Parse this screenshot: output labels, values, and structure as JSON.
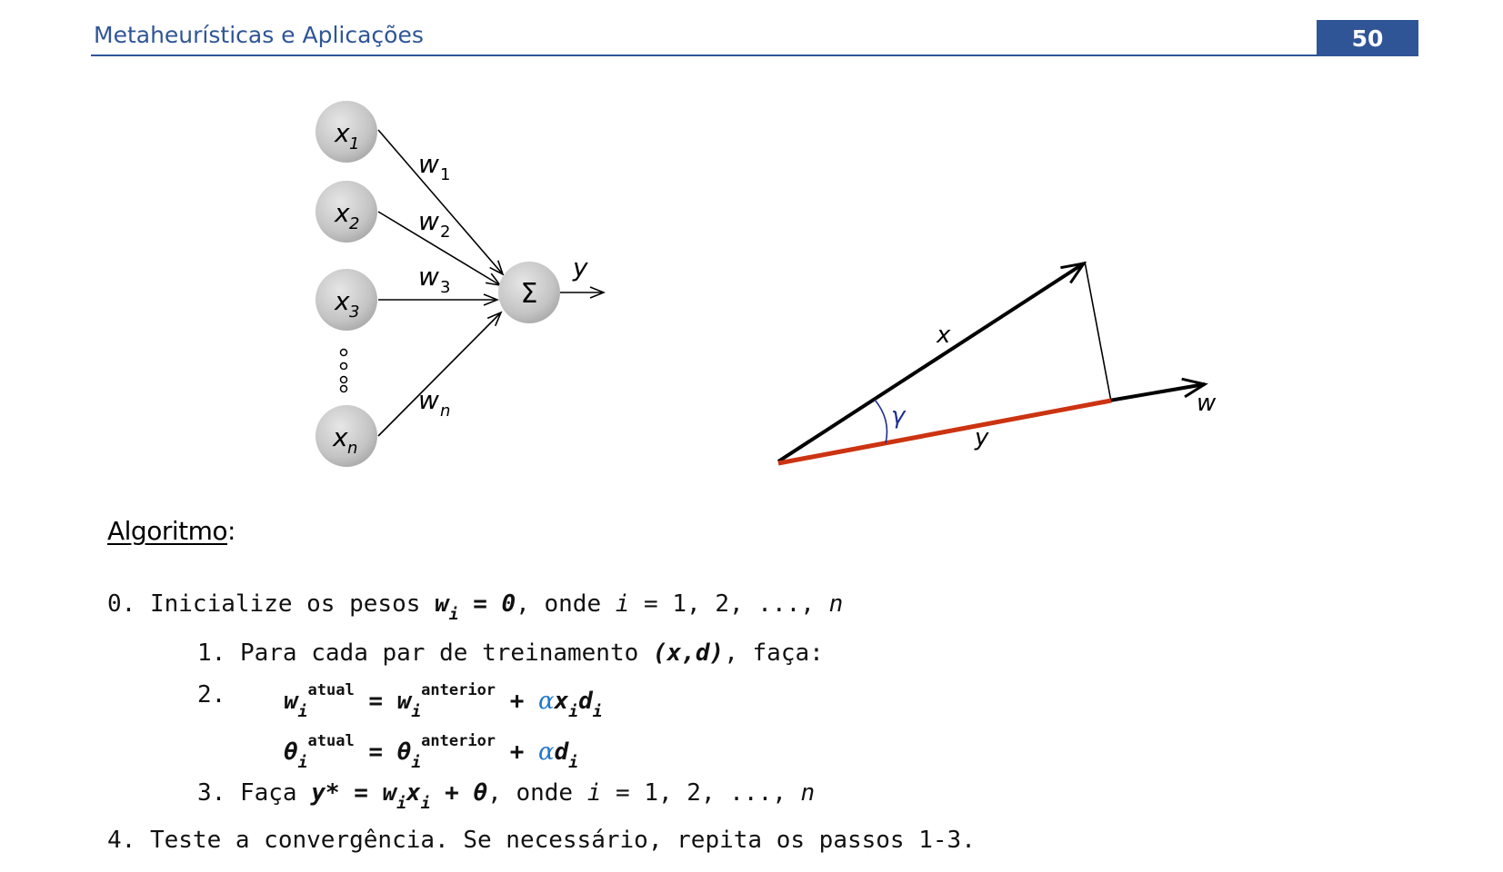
{
  "header": {
    "title": "Metaheurísticas e Aplicações",
    "page_number": "50"
  },
  "neuron_diagram": {
    "inputs": [
      "x",
      "x",
      "x",
      "x"
    ],
    "input_subscripts": [
      "1",
      "2",
      "3",
      "n"
    ],
    "weights": [
      "w",
      "w",
      "w",
      "w"
    ],
    "weight_subscripts": [
      "1",
      "2",
      "3",
      "n"
    ],
    "sum_symbol": "Σ",
    "output_label": "y"
  },
  "vector_diagram": {
    "x_label": "x",
    "w_label": "w",
    "y_label": "y",
    "angle_label": "γ"
  },
  "algorithm": {
    "heading": "Algoritmo",
    "heading_colon": ":",
    "line0": {
      "num": "0. ",
      "text": "Inicialize os pesos ",
      "var": "w",
      "sub": "i",
      "eq": " = ",
      "zero": "0",
      "comma": ", onde ",
      "i": "i",
      "range": " = 1, 2, ..., ",
      "n": "n"
    },
    "line1": {
      "num": "1. ",
      "text": "Para cada par de treinamento ",
      "pair": "(x,d)",
      "rest": ", faça:"
    },
    "line2": {
      "num": "2.",
      "w": "w",
      "sub": "i",
      "sup_cur": "atual",
      "eq": " = ",
      "sup_prev": "anterior",
      "plus": " + ",
      "alpha": "α",
      "x": "x",
      "d": "d"
    },
    "line2b": {
      "theta": "θ",
      "sub": "i",
      "sup_cur": "atual",
      "eq": " = ",
      "sup_prev": "anterior",
      "plus": " + ",
      "alpha": "α",
      "d": "d"
    },
    "line3": {
      "num": "3. ",
      "text": "Faça ",
      "y": "y*",
      "eq": " = ",
      "w": "w",
      "x": "x",
      "plus": " + ",
      "theta": "θ",
      "comma": ", onde ",
      "i": "i",
      "range": " = 1, 2, ..., ",
      "n": "n"
    },
    "line4": {
      "text": "4. Teste a convergência. Se necessário, repita os passos 1-3."
    }
  },
  "colors": {
    "header_blue": "#2f5597",
    "y_segment": "#cc3311",
    "alpha_blue": "#1f77c9",
    "angle_blue": "#1f2f8f"
  }
}
